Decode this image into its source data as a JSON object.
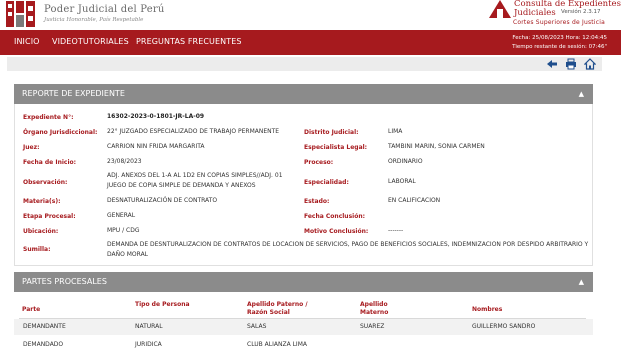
{
  "header": {
    "org_name": "Poder Judicial del Perú",
    "org_motto": "Justicia Honorable, País Respetable",
    "app_title_line1": "Consulta de Expedientes",
    "app_title_line2": "Judiciales",
    "app_version": "Versión 2.3.17",
    "app_sub": "Cortes Superiores de Justicia"
  },
  "nav": {
    "items": [
      "INICIO",
      "VIDEOTUTORIALES",
      "PREGUNTAS FRECUENTES"
    ],
    "session_date": "Fecha: 25/08/2023 Hora: 12:04:45",
    "session_time": "Tiempo restante de sesión: 07:46\""
  },
  "toolbar": {
    "icons": [
      "back-arrow-icon",
      "print-icon",
      "home-icon"
    ]
  },
  "colors": {
    "brand_red": "#a61a1e",
    "panel_grey": "#8b8b8b"
  },
  "reporte": {
    "title": "REPORTE DE EXPEDIENTE",
    "caret": "▲",
    "fields": {
      "expediente_label": "Expediente N°:",
      "expediente_value": "16302-2023-0-1801-JR-LA-09",
      "organo_label": "Órgano Jurisdiccional:",
      "organo_value": "22° JUZGADO ESPECIALIZADO DE TRABAJO PERMANENTE",
      "distrito_label": "Distrito Judicial:",
      "distrito_value": "LIMA",
      "juez_label": "Juez:",
      "juez_value": "CARRION NIN FRIDA MARGARITA",
      "especialista_label": "Especialista Legal:",
      "especialista_value": "TAMBINI MARIN, SONIA CARMEN",
      "fecha_inicio_label": "Fecha de Inicio:",
      "fecha_inicio_value": "23/08/2023",
      "proceso_label": "Proceso:",
      "proceso_value": "ORDINARIO",
      "observacion_label": "Observación:",
      "observacion_value": "ADJ. ANEXOS DEL 1-A AL 1D2 EN COPIAS SIMPLES//ADJ. 01 JUEGO DE COPIA SIMPLE DE DEMANDA Y ANEXOS",
      "especialidad_label": "Especialidad:",
      "especialidad_value": "LABORAL",
      "materia_label": "Materia(s):",
      "materia_value": "DESNATURALIZACIÓN DE CONTRATO",
      "estado_label": "Estado:",
      "estado_value": "EN CALIFICACION",
      "etapa_label": "Etapa Procesal:",
      "etapa_value": "GENERAL",
      "fecha_conclusion_label": "Fecha Conclusión:",
      "fecha_conclusion_value": "",
      "ubicacion_label": "Ubicación:",
      "ubicacion_value": "MPU / CDG",
      "motivo_label": "Motivo Conclusión:",
      "motivo_value": "-------",
      "sumilla_label": "Sumilla:",
      "sumilla_value": "DEMANDA DE DESNTURALIZACION DE CONTRATOS DE LOCACION DE SERVICIOS, PAGO DE BENEFICIOS SOCIALES, INDEMNIZACION POR DESPIDO ARBITRARIO Y DAÑO MORAL"
    }
  },
  "partes": {
    "title": "PARTES PROCESALES",
    "caret": "▲",
    "columns": [
      "Parte",
      "Tipo de Persona",
      "Apellido Paterno / Razón Social",
      "Apellido Materno",
      "Nombres"
    ],
    "rows": [
      [
        "DEMANDANTE",
        "NATURAL",
        "SALAS",
        "SUAREZ",
        "GUILLERMO SANDRO"
      ],
      [
        "DEMANDADO",
        "JURIDICA",
        "CLUB ALIANZA LIMA",
        "",
        ""
      ]
    ]
  }
}
